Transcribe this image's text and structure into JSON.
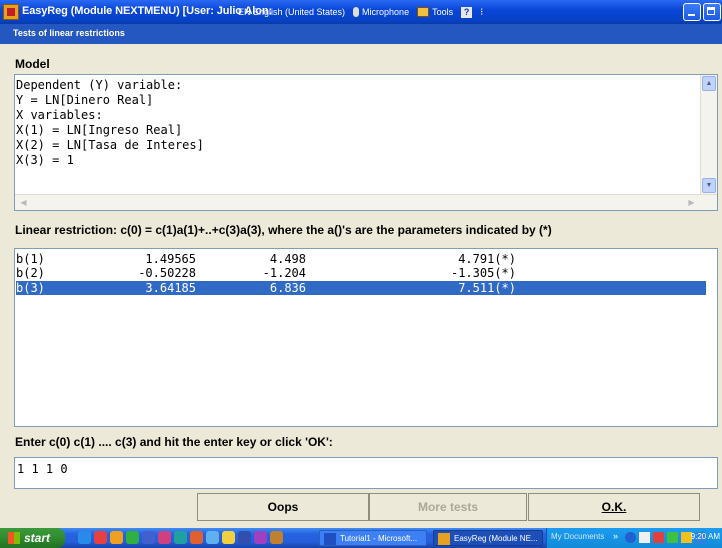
{
  "window": {
    "title": "EasyReg (Module NEXTMENU) [User: Julio Alon:",
    "subtitle": "Tests of linear restrictions"
  },
  "langbar": {
    "language": "EN English (United States)",
    "microphone": "Microphone",
    "tools": "Tools",
    "help": "?",
    "more": "⁝"
  },
  "model": {
    "heading": "Model",
    "lines": [
      "Dependent (Y) variable:",
      "Y = LN[Dinero Real]",
      "X variables:",
      "X(1) = LN[Ingreso Real]",
      "X(2) = LN[Tasa de Interes]",
      "X(3) = 1"
    ]
  },
  "restriction": {
    "heading": "Linear restriction: c(0) = c(1)a(1)+..+c(3)a(3), where the a()'s are the parameters indicated by (*)",
    "rows": [
      {
        "name": "b(1)",
        "v1": "1.49565",
        "v2": "4.498",
        "v3": "4.791(*)"
      },
      {
        "name": "b(2)",
        "v1": "-0.50228",
        "v2": "-1.204",
        "v3": "-1.305(*)"
      },
      {
        "name": "b(3)",
        "v1": "3.64185",
        "v2": "6.836",
        "v3": "7.511(*)"
      }
    ],
    "selected_index": 2
  },
  "entry": {
    "prompt": "Enter c(0) c(1) .... c(3) and hit the enter key or click 'OK':",
    "value": "1 1 1 0"
  },
  "buttons": {
    "oops": "Oops",
    "more_tests": "More tests",
    "ok": "O.K."
  },
  "taskbar": {
    "start": "start",
    "tasks": [
      "Tutorial1 - Microsoft...",
      "EasyReg (Module NE..."
    ],
    "tray_text": "My Documents",
    "tray_chevron": "»",
    "clock": "9:20 AM"
  },
  "colors": {
    "title_bar": "#0a46d8",
    "subtitle_bar": "#2457c0",
    "selection": "#316ac5",
    "window_bg": "#ece9d8",
    "taskbar": "#245edb",
    "start_button": "#2f8a2f"
  }
}
